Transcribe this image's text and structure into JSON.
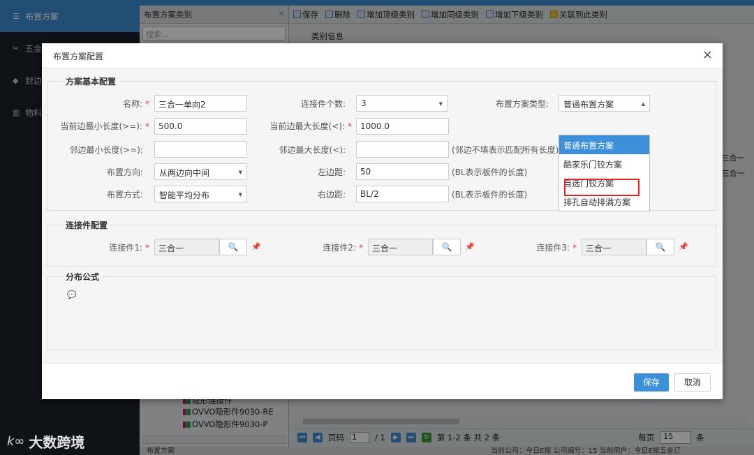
{
  "background": {
    "sidebar": {
      "items": [
        {
          "label": "布置方案",
          "icon": "list-icon"
        },
        {
          "label": "五金",
          "icon": "tools-icon"
        },
        {
          "label": "封边",
          "icon": "cube-icon"
        },
        {
          "label": "物料",
          "icon": "bars-icon"
        }
      ]
    },
    "tree": {
      "title": "布置方案类别",
      "collapse": "«",
      "search_placeholder": "搜索...",
      "nodes": [
        "隐形连接件",
        "OVVO隐形件9030-RE",
        "OVVO隐形件9030-P"
      ]
    },
    "toolbar": {
      "items": [
        "保存",
        "删除",
        "增加顶级类别",
        "增加同级类别",
        "增加下级类别",
        "关联到此类别"
      ]
    },
    "section_title": "类别信息",
    "grid_right": [
      ",三合一",
      ",三合一"
    ],
    "pager": {
      "page_label": "页码",
      "page_value": "1",
      "total_pages": "/ 1",
      "range": "第 1-2 条  共 2 条",
      "per_page_label": "每页",
      "per_page": "15",
      "tail": "条"
    },
    "status_left": "布置方案",
    "status_right": "当前公司：今日E振  公司编号：15  当前用户：今日E振五金订"
  },
  "watermark": {
    "logo": "k∞",
    "text": "大数跨境"
  },
  "dialog": {
    "title": "布置方案配置",
    "close": "×",
    "basic": {
      "legend": "方案基本配置",
      "name_label": "名称:",
      "name_value": "三合一单向2",
      "conn_count_label": "连接件个数:",
      "conn_count_value": "3",
      "type_label": "布置方案类型:",
      "type_value": "普通布置方案",
      "min_len_label": "当前边最小长度(>=):",
      "min_len_value": "500.0",
      "max_len_label": "当前边最大长度(<):",
      "max_len_value": "1000.0",
      "adj_min_label": "邻边最小长度(>=):",
      "adj_min_value": "",
      "adj_max_label": "邻边最大长度(<):",
      "adj_max_value": "",
      "adj_hint": "(邻边不填表示匹配所有长度)",
      "direction_label": "布置方向:",
      "direction_value": "从两边向中间",
      "left_margin_label": "左边距:",
      "left_margin_value": "50",
      "left_hint": "(BL表示板件的长度)",
      "method_label": "布置方式:",
      "method_value": "智能平均分布",
      "right_margin_label": "右边距:",
      "right_margin_value": "BL/2",
      "right_hint": "(BL表示板件的长度)"
    },
    "type_options": [
      "普通布置方案",
      "酷家乐门铰方案",
      "自选门铰方案",
      "排孔自动排满方案"
    ],
    "connectors": {
      "legend": "连接件配置",
      "items": [
        {
          "label": "连接件1:",
          "value": "三合一"
        },
        {
          "label": "连接件2:",
          "value": "三合一"
        },
        {
          "label": "连接件3:",
          "value": "三合一"
        }
      ]
    },
    "formula": {
      "legend": "分布公式"
    },
    "save_label": "保存",
    "cancel_label": "取消"
  }
}
